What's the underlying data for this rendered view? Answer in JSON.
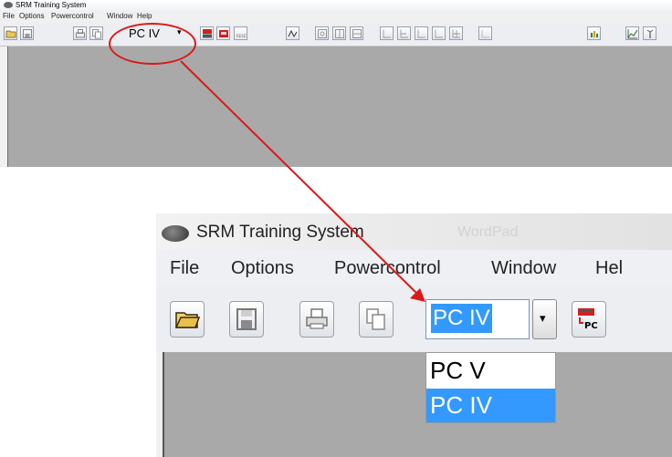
{
  "top_window": {
    "title": "SRM Training System",
    "menu": [
      "File",
      "Options",
      "Powercontrol",
      "Window",
      "Help"
    ],
    "combo_value": "PC IV",
    "combo_arrow": "▾",
    "toolbar_icons": [
      "open-icon",
      "save-icon",
      "print-icon",
      "copy-icon",
      "pc-download-icon",
      "pc-icon",
      "reset-icon",
      "signal-icon",
      "layout-1-icon",
      "layout-2-icon",
      "layout-3-icon",
      "layout-4-icon",
      "layout-5-icon",
      "layout-6-icon",
      "layout-7-icon",
      "layout-8-icon",
      "layout-9-icon",
      "chart-icon",
      "graph-icon",
      "antenna-icon"
    ]
  },
  "zoom_window": {
    "title": "SRM Training System",
    "background_title": "WordPad",
    "menu": [
      "File",
      "Options",
      "Powercontrol",
      "Window",
      "Hel"
    ],
    "combo_value": "PC IV",
    "combo_arrow": "▾",
    "dropdown_options": [
      "PC V",
      "PC IV"
    ],
    "selected_option": "PC IV",
    "pc_button_label": "PC"
  },
  "colors": {
    "highlight": "#3399ff",
    "annotation": "#d91a1a",
    "workspace": "#a9a9a9"
  }
}
